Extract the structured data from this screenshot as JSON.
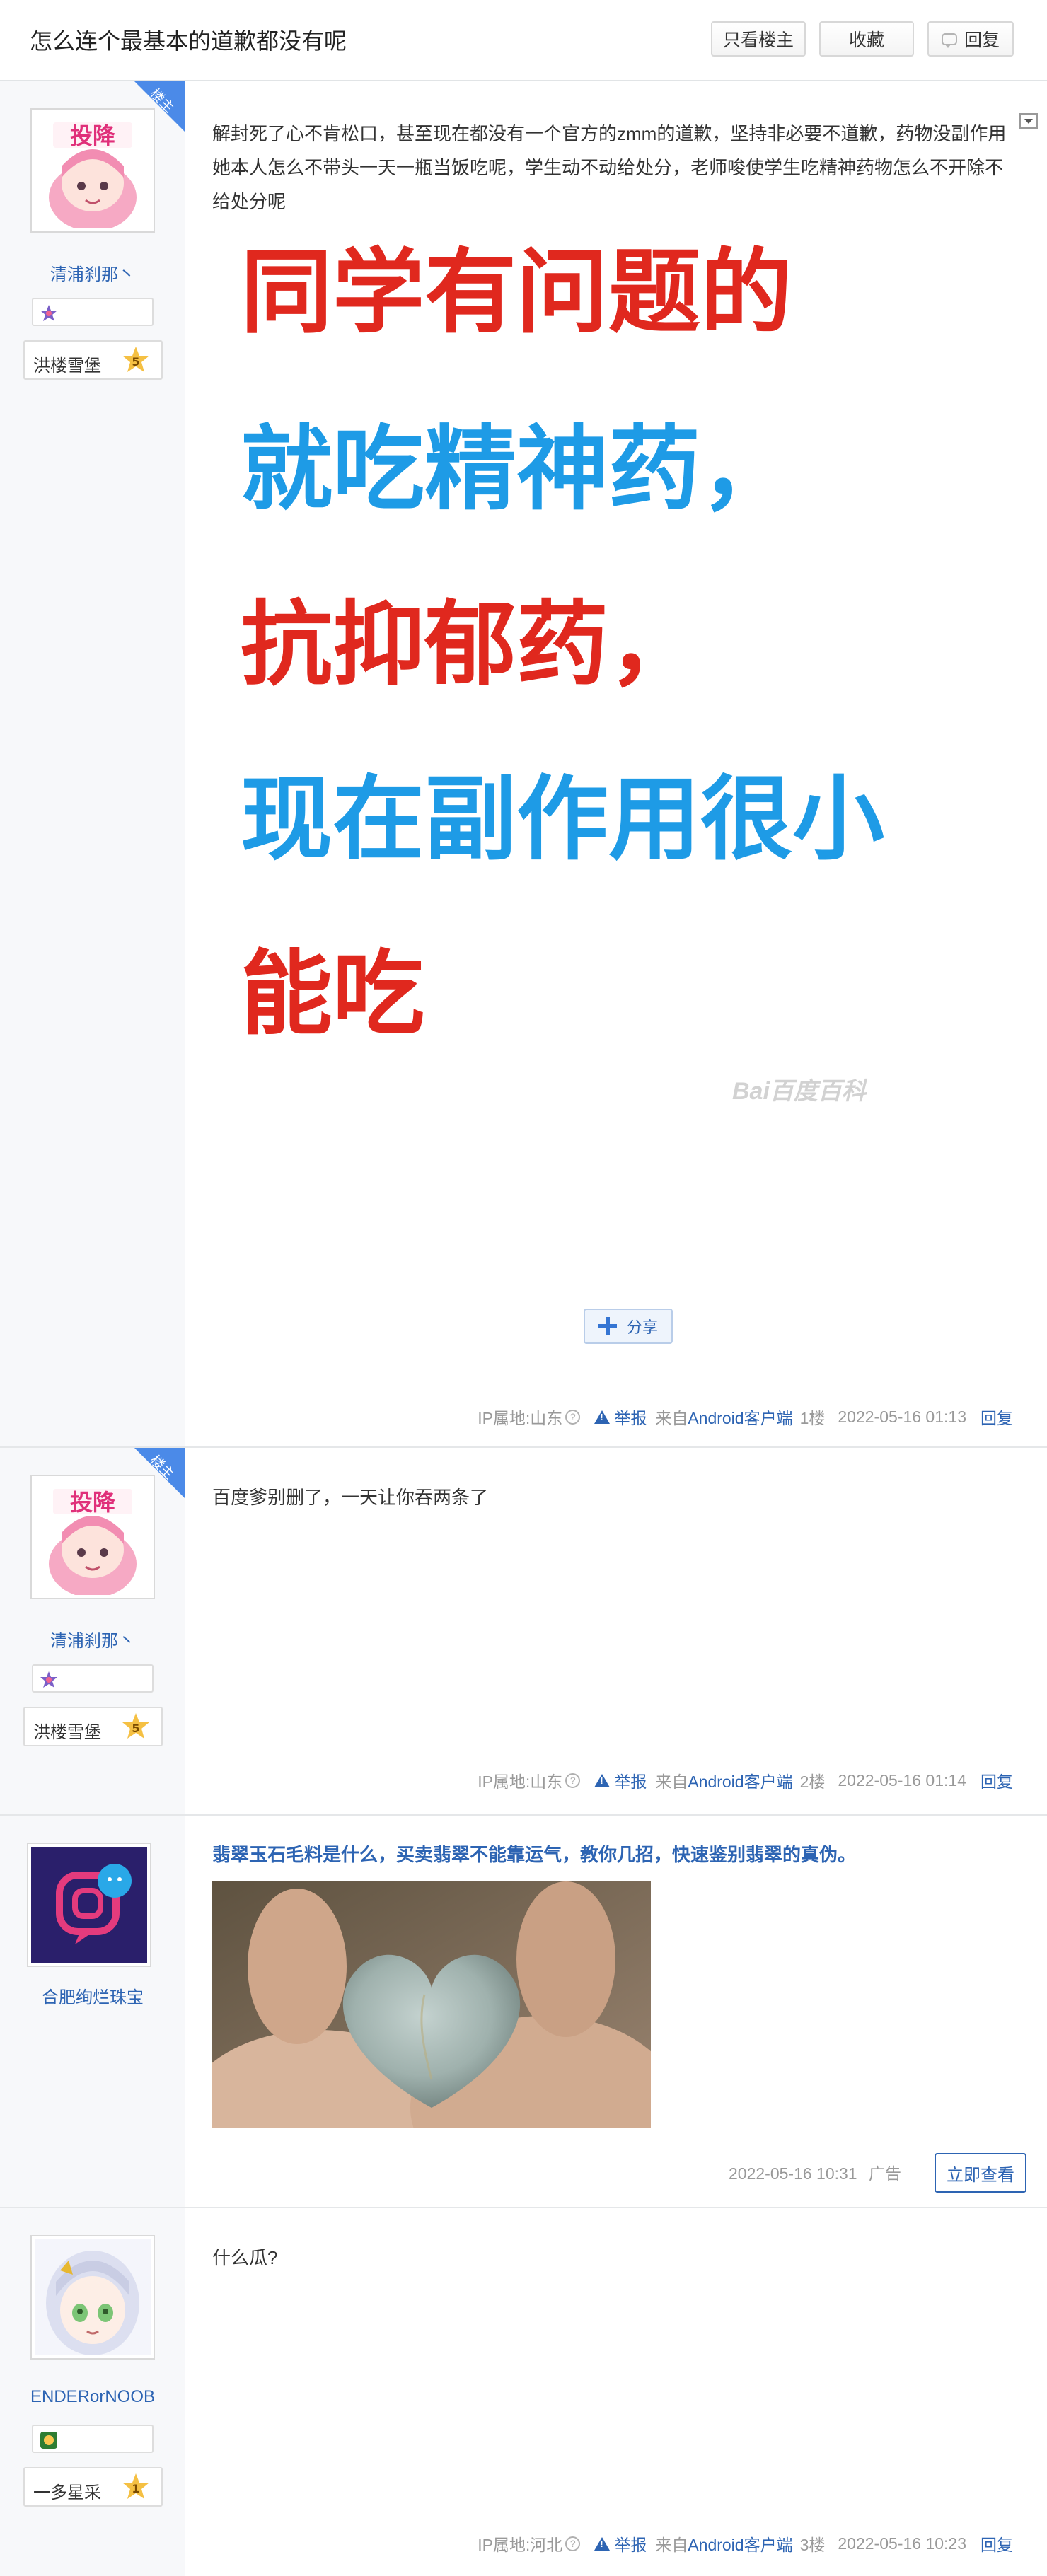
{
  "header": {
    "title": "怎么连个最基本的道歉都没有呢",
    "buttons": {
      "only_op": "只看楼主",
      "favorite": "收藏",
      "reply": "回复"
    },
    "reply_icon": "comment-bubble-icon"
  },
  "posts": [
    {
      "louzhu_badge": "楼主",
      "username": "清浦刹那丶",
      "avatar_text": "投降",
      "level_name": "洪楼雪堡",
      "level_num": "5",
      "text": "解封死了心不肯松口，甚至现在都没有一个官方的zmm的道歉，坚持非必要不道歉，药物没副作用她本人怎么不带头一天一瓶当饭吃呢，学生动不动给处分，老师唆使学生吃精神药物怎么不开除不给处分呢",
      "meme": {
        "line1": "同学有问题的",
        "line2": "就吃精神药，",
        "line3": "抗抑郁药，",
        "line4": "现在副作用很小",
        "line5": "能吃",
        "watermark": "Bai百度百科",
        "colors": {
          "red": "#e0281e",
          "blue": "#1e9be6"
        }
      },
      "share": "分享",
      "meta": {
        "ip": "IP属地:山东",
        "report": "举报",
        "from_prefix": "来自",
        "client": "Android客户端",
        "floor": "1楼",
        "time": "2022-05-16 01:13",
        "reply": "回复"
      }
    },
    {
      "louzhu_badge": "楼主",
      "username": "清浦刹那丶",
      "avatar_text": "投降",
      "level_name": "洪楼雪堡",
      "level_num": "5",
      "text": "百度爹别删了，一天让你吞两条了",
      "meta": {
        "ip": "IP属地:山东",
        "report": "举报",
        "from_prefix": "来自",
        "client": "Android客户端",
        "floor": "2楼",
        "time": "2022-05-16 01:14",
        "reply": "回复"
      }
    },
    {
      "username": "ENDERorNOOB",
      "level_name": "一多星采",
      "level_num": "1",
      "text": "什么瓜?",
      "meta": {
        "ip": "IP属地:河北",
        "report": "举报",
        "from_prefix": "来自",
        "client": "Android客户端",
        "floor": "3楼",
        "time": "2022-05-16 10:23",
        "reply": "回复"
      }
    }
  ],
  "ad": {
    "advertiser": "合肥绚烂珠宝",
    "title": "翡翠玉石毛料是什么，买卖翡翠不能靠运气，教你几招，快速鉴别翡翠的真伪。",
    "time": "2022-05-16 10:31",
    "label": "广告",
    "button": "立即查看"
  },
  "accent_color": "#2d64b3"
}
